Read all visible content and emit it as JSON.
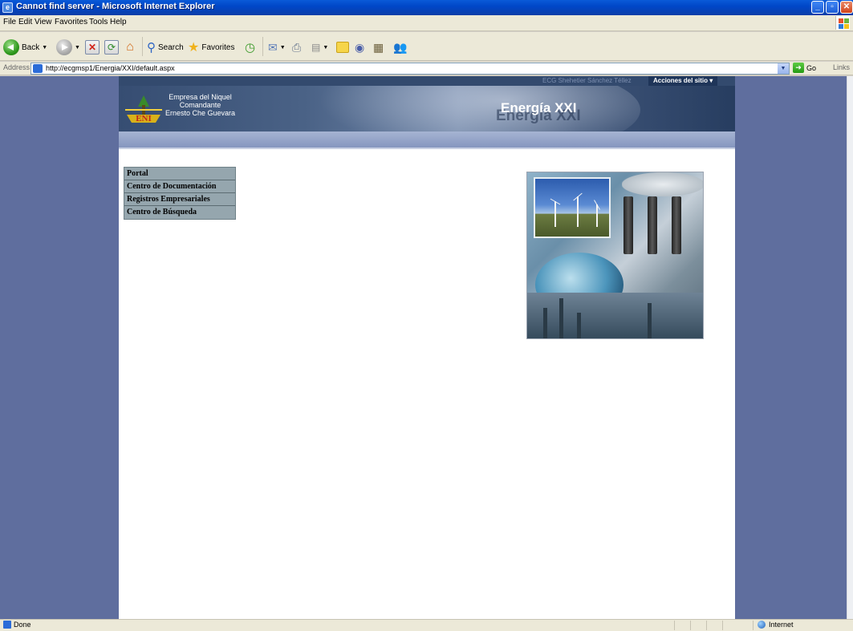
{
  "window": {
    "title": "Cannot find server - Microsoft Internet Explorer",
    "app_icon": "ie-icon",
    "controls": [
      "minimize-icon",
      "maximize-icon",
      "close-icon"
    ]
  },
  "menu": [
    "File",
    "Edit",
    "View",
    "Favorites",
    "Tools",
    "Help"
  ],
  "toolbar": {
    "back_label": "Back",
    "search_label": "Search",
    "favorites_label": "Favorites"
  },
  "address": {
    "label": "Address",
    "url": "http://ecgmsp1/Energia/XXI/default.aspx",
    "go_label": "Go",
    "links_label": "Links"
  },
  "site": {
    "user": "ECG Shehetier Sánchez Téllez",
    "actions": "Acciones del sitio",
    "org_lines": [
      "Empresa del Niquel",
      "Comandante",
      "Ernesto Che Guevara"
    ],
    "title": "Energía XXI",
    "quick_nav": [
      "Portal",
      "Centro de Documentación",
      "Registros Empresariales",
      "Centro de Búsqueda"
    ]
  },
  "status": {
    "left": "Done",
    "zone": "Internet"
  },
  "colors": {
    "page_background": "#5f6e9e",
    "banner": "#364d72",
    "nav_band": "#8596bf",
    "quick_nav": "#95a6ae"
  }
}
